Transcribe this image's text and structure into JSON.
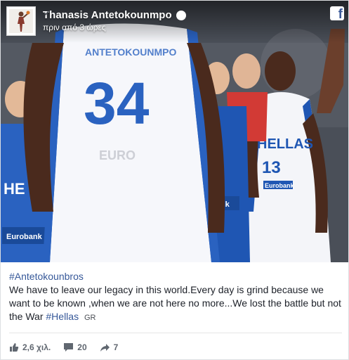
{
  "author": {
    "name": "Thanasis Antetokounmpo",
    "timestamp": "πριν από 3 ώρες"
  },
  "photo": {
    "jersey_number_left": "34",
    "jersey_name_left": "ANTETOKOUNMPO",
    "jersey_number_right": "13",
    "jersey_text_right": "HELLAS",
    "sponsor": "Eurobank"
  },
  "post": {
    "hashtag_top": "#Antetokounbros",
    "body": "We have to leave our legacy in this world.Every day is grind because we want to be known ,when we are not here no more...We lost the battle but not the War",
    "hashtag_end": "#Hellas",
    "language": "GR"
  },
  "stats": {
    "likes": "2,6 χιλ.",
    "comments": "20",
    "shares": "7"
  },
  "colors": {
    "link": "#365899",
    "facebook": "#3b5998",
    "jersey_blue": "#1f56b3"
  }
}
